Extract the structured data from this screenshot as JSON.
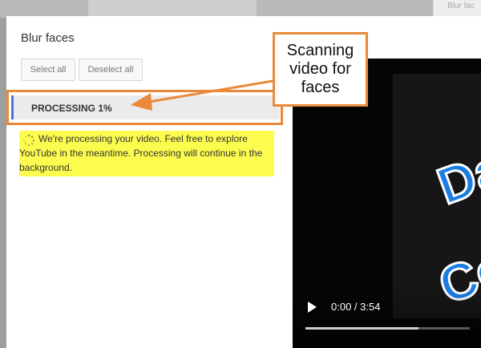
{
  "background": {
    "side_text": "Blur fac"
  },
  "dialog": {
    "title": "Blur faces",
    "select_all": "Select all",
    "deselect_all": "Deselect all",
    "processing_label": "PROCESSING 1%",
    "progress_percent": 1,
    "notice": "We're processing your video. Feel free to explore YouTube in the meantime. Processing will continue in the background."
  },
  "player": {
    "time": "0:00 / 3:54",
    "thumbnail_words": [
      "Da",
      "Co"
    ],
    "seek_fraction": 0.69
  },
  "callout": {
    "text": "Scanning\nvideo for\nfaces"
  },
  "colors": {
    "highlight_orange": "#e9893a",
    "notice_yellow": "#fcfc4e",
    "processing_accent": "#4a74d9",
    "thumbnail_blue": "#1b7ce2"
  },
  "icons": {
    "spinner": "loading-spinner-icon",
    "play": "play-icon"
  }
}
